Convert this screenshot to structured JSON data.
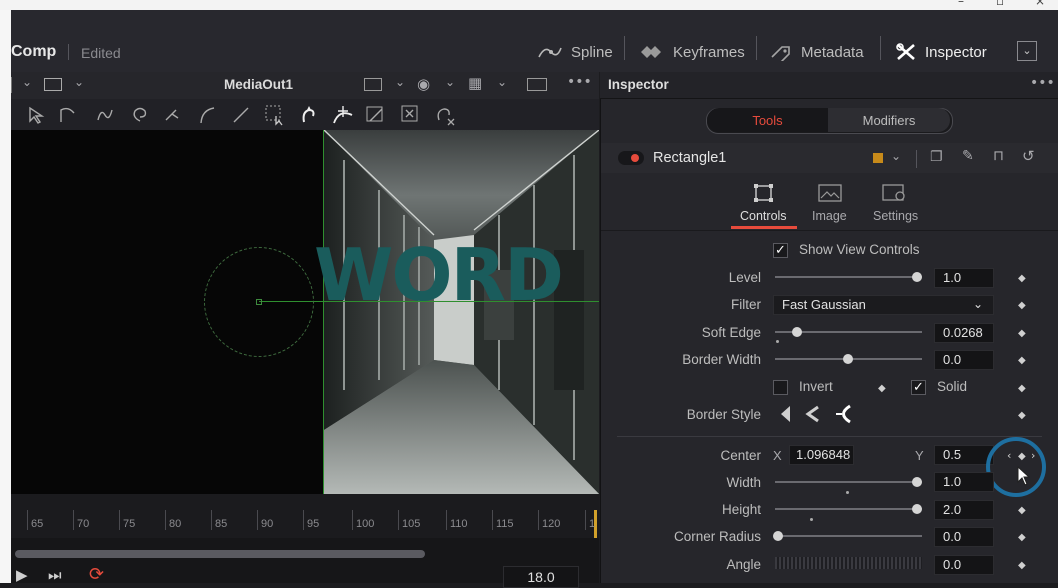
{
  "app": {
    "title": "Comp",
    "status": "Edited"
  },
  "toolbar": {
    "spline": "Spline",
    "keyframes": "Keyframes",
    "metadata": "Metadata",
    "inspector": "Inspector"
  },
  "viewer": {
    "title": "MediaOut1",
    "overlay_text": "WORD"
  },
  "timeline": {
    "ticks": [
      "65",
      "70",
      "75",
      "80",
      "85",
      "90",
      "95",
      "100",
      "105",
      "110",
      "115",
      "120",
      "1"
    ],
    "frame": "18.0"
  },
  "inspector": {
    "header": "Inspector",
    "tabs": {
      "tools": "Tools",
      "modifiers": "Modifiers"
    },
    "node": "Rectangle1",
    "subtabs": {
      "controls": "Controls",
      "image": "Image",
      "settings": "Settings"
    },
    "show_view_controls": "Show View Controls",
    "level": {
      "label": "Level",
      "value": "1.0"
    },
    "filter": {
      "label": "Filter",
      "value": "Fast Gaussian"
    },
    "soft_edge": {
      "label": "Soft Edge",
      "value": "0.0268"
    },
    "border_width": {
      "label": "Border Width",
      "value": "0.0"
    },
    "invert": "Invert",
    "solid": "Solid",
    "border_style": {
      "label": "Border Style"
    },
    "center": {
      "label": "Center",
      "x_label": "X",
      "x_value": "1.096848",
      "y_label": "Y",
      "y_value": "0.5"
    },
    "width": {
      "label": "Width",
      "value": "1.0"
    },
    "height": {
      "label": "Height",
      "value": "2.0"
    },
    "corner_radius": {
      "label": "Corner Radius",
      "value": "0.0"
    },
    "angle": {
      "label": "Angle",
      "value": "0.0"
    }
  },
  "colors": {
    "accent_red": "#e64b3c",
    "highlight_blue": "#1e6fa0",
    "overlay_text": "#1a5c5c"
  }
}
